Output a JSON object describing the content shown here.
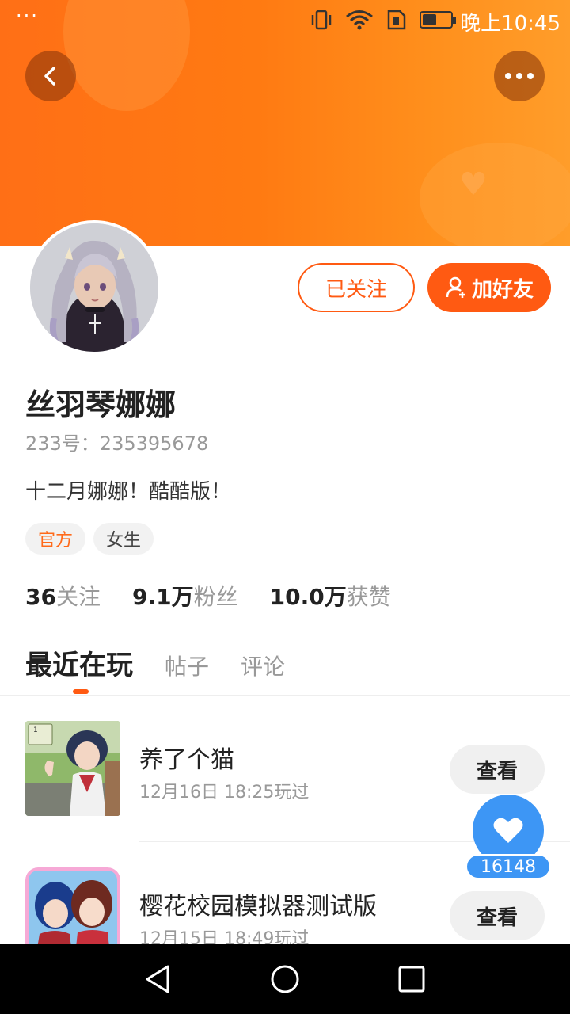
{
  "status_bar": {
    "overflow": "···",
    "time": "晚上10:45",
    "battery_level": 0.5,
    "icons": [
      "vibrate-icon",
      "wifi-icon",
      "sim-icon",
      "battery-icon"
    ]
  },
  "header": {
    "back_icon": "back-arrow-icon",
    "more_icon": "more-dots-icon"
  },
  "profile": {
    "follow_label": "已关注",
    "add_friend_label": "加好友",
    "username": "丝羽琴娜娜",
    "account_id": "233号：235395678",
    "bio": "十二月娜娜！酷酷版！",
    "tags": [
      {
        "label": "官方"
      },
      {
        "label": "女生"
      }
    ],
    "stats": [
      {
        "num": "36",
        "label": "关注"
      },
      {
        "num": "9.1万",
        "label": "粉丝"
      },
      {
        "num": "10.0万",
        "label": "获赞"
      }
    ]
  },
  "tabs": [
    {
      "label": "最近在玩",
      "active": true
    },
    {
      "label": "帖子",
      "active": false
    },
    {
      "label": "评论",
      "active": false
    }
  ],
  "games": [
    {
      "title": "养了个猫",
      "time": "12月16日 18:25玩过",
      "button": "查看",
      "thumb_badge": "1"
    },
    {
      "title": "樱花校园模拟器测试版",
      "time": "12月15日 18:49玩过",
      "button": "查看"
    }
  ],
  "like": {
    "count": "16148"
  },
  "colors": {
    "accent": "#ff5a12",
    "banner": "#ff7a12",
    "like": "#3d96f5"
  }
}
